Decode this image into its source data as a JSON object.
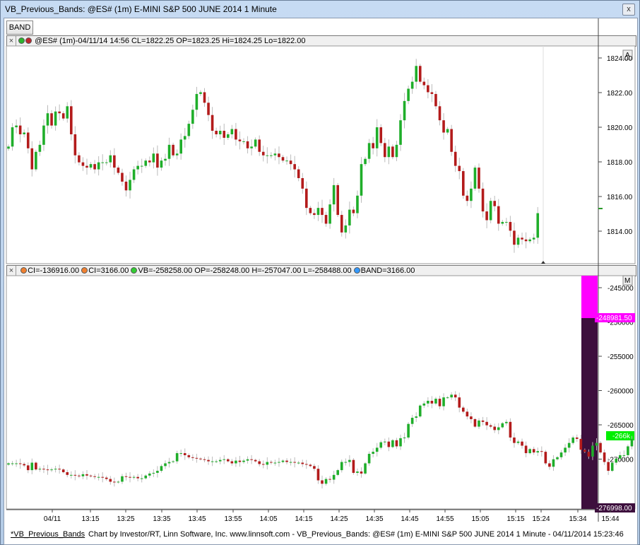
{
  "window": {
    "title": "VB_Previous_Bands: @ES# (1m) E-MINI S&P 500 JUNE 2014 1 Minute",
    "close_label": "x"
  },
  "toolbar": {
    "tab_label": "BAND"
  },
  "price_pane": {
    "header": "@ES# (1m)-04/11/14 14:56 CL=1822.25 OP=1823.25 Hi=1824.25 Lo=1822.00",
    "corner_label": "A",
    "y_ticks": [
      "1824.00",
      "1822.00",
      "1820.00",
      "1818.00",
      "1816.00",
      "1814.00"
    ]
  },
  "indicator_pane": {
    "items": [
      {
        "text": "CI=-136916.00",
        "color": "#f08030"
      },
      {
        "text": "CI=3166.00",
        "color": "#f08030"
      },
      {
        "text": "VB=-258258.00 OP=-258248.00 H=-257047.00 L=-258488.00",
        "color": "#33cc33"
      },
      {
        "text": "BAND=3166.00",
        "color": "#3399ff"
      }
    ],
    "corner_label": "M",
    "y_ticks": [
      "-245000",
      "-250000",
      "-255000",
      "-260000",
      "-265000",
      "-270000"
    ],
    "top_badge": "-248981.50",
    "bottom_badge": "-276998.00",
    "last_badge": "-266k"
  },
  "x_axis": {
    "ticks": [
      "04/11",
      "13:15",
      "13:25",
      "13:35",
      "13:45",
      "13:55",
      "14:05",
      "14:15",
      "14:25",
      "14:35",
      "14:45",
      "14:55",
      "15:05",
      "15:15",
      "15:24",
      "15:34",
      "15:44"
    ]
  },
  "status_bar": {
    "link": "*VB_Previous_Bands",
    "text": "Chart by Investor/RT, Linn Software, Inc. www.linnsoft.com - VB_Previous_Bands: @ES# (1m) E-MINI S&P 500 JUNE 2014 1 Minute - 04/11/2014 15:23:46"
  },
  "colors": {
    "up": "#1fae2a",
    "down": "#b31b1b",
    "band_top": "#ff00ff",
    "band_body": "#3d0f3d",
    "last": "#00ee00"
  },
  "chart_data": [
    {
      "type": "candlestick",
      "title": "@ES# (1m)",
      "ylim": [
        1812.6,
        1824.9
      ],
      "x_start": "13:07",
      "x_end": "15:24",
      "close": [
        1819.2,
        1820.3,
        1820.4,
        1819.9,
        1820.0,
        1819.1,
        1817.9,
        1818.9,
        1819.3,
        1820.4,
        1821.1,
        1820.4,
        1821.2,
        1821.1,
        1820.8,
        1821.5,
        1819.9,
        1818.7,
        1818.3,
        1818.1,
        1818.0,
        1818.2,
        1817.9,
        1818.3,
        1818.3,
        1818.3,
        1818.7,
        1818.0,
        1817.7,
        1817.2,
        1816.7,
        1817.3,
        1817.9,
        1818.1,
        1818.1,
        1818.4,
        1818.3,
        1818.8,
        1818.0,
        1818.4,
        1818.5,
        1819.3,
        1818.7,
        1818.8,
        1819.6,
        1819.8,
        1820.5,
        1821.3,
        1822.2,
        1822.3,
        1821.7,
        1821.0,
        1820.1,
        1819.9,
        1820.1,
        1819.7,
        1819.9,
        1820.2,
        1819.6,
        1819.5,
        1819.5,
        1819.1,
        1819.2,
        1819.6,
        1818.9,
        1818.7,
        1818.7,
        1818.7,
        1818.8,
        1818.6,
        1818.4,
        1818.4,
        1818.2,
        1817.9,
        1817.4,
        1816.8,
        1815.7,
        1815.4,
        1815.3,
        1815.7,
        1815.3,
        1814.8,
        1815.9,
        1817.0,
        1815.3,
        1814.3,
        1814.7,
        1815.6,
        1815.4,
        1816.4,
        1818.2,
        1818.5,
        1819.4,
        1819.1,
        1820.3,
        1819.4,
        1818.6,
        1819.2,
        1818.6,
        1819.3,
        1820.7,
        1821.8,
        1822.5,
        1822.9,
        1823.8,
        1822.9,
        1822.7,
        1822.3,
        1822.2,
        1821.5,
        1820.7,
        1820.0,
        1820.2,
        1818.9,
        1818.1,
        1817.8,
        1816.4,
        1816.1,
        1816.8,
        1818.0,
        1816.8,
        1815.5,
        1815.0,
        1816.1,
        1815.8,
        1814.8,
        1814.9,
        1814.9,
        1814.4,
        1813.6,
        1814.0,
        1813.9,
        1813.8,
        1813.9,
        1814.0,
        1815.4
      ]
    },
    {
      "type": "candlestick",
      "title": "VB",
      "ylim": [
        -277000,
        -243000
      ],
      "close": [
        -270500,
        -270500,
        -270500,
        -270600,
        -270800,
        -271500,
        -270400,
        -271400,
        -271300,
        -271400,
        -271500,
        -271400,
        -271300,
        -271400,
        -271800,
        -272200,
        -272200,
        -272300,
        -272400,
        -272100,
        -272300,
        -272400,
        -272500,
        -272500,
        -272600,
        -272800,
        -273200,
        -273300,
        -273200,
        -272400,
        -272500,
        -272600,
        -272500,
        -272700,
        -272700,
        -272300,
        -272000,
        -271900,
        -271600,
        -270900,
        -270500,
        -270300,
        -270200,
        -269000,
        -269000,
        -269300,
        -269600,
        -269700,
        -269800,
        -269900,
        -270000,
        -270200,
        -270200,
        -270200,
        -270000,
        -269900,
        -270200,
        -270500,
        -270100,
        -270300,
        -270100,
        -269900,
        -270000,
        -270200,
        -270600,
        -270700,
        -270300,
        -270400,
        -270400,
        -270300,
        -270100,
        -270300,
        -270300,
        -270400,
        -270400,
        -270600,
        -270700,
        -270900,
        -271300,
        -273000,
        -273500,
        -272800,
        -272900,
        -272200,
        -271500,
        -270300,
        -270300,
        -270000,
        -271900,
        -271700,
        -272000,
        -270500,
        -269100,
        -268800,
        -268200,
        -267400,
        -267300,
        -268100,
        -267100,
        -268000,
        -266800,
        -266700,
        -264700,
        -263800,
        -263600,
        -262000,
        -261700,
        -261300,
        -261700,
        -261000,
        -262100,
        -260800,
        -260800,
        -260400,
        -260800,
        -262300,
        -262900,
        -263600,
        -264000,
        -265100,
        -264200,
        -264400,
        -264900,
        -265100,
        -265600,
        -265200,
        -264600,
        -264400,
        -266700,
        -267500,
        -267300,
        -267900,
        -269000,
        -268400,
        -268900,
        -268700,
        -268800,
        -270500,
        -271000,
        -269900,
        -269600,
        -268900,
        -268200,
        -267500,
        -266700,
        -266900,
        -268500,
        -268800,
        -269500,
        -267900,
        -267500,
        -268900,
        -270300,
        -271600,
        -270400,
        -269800,
        -269300,
        -269300,
        -268000,
        -266900
      ]
    }
  ]
}
